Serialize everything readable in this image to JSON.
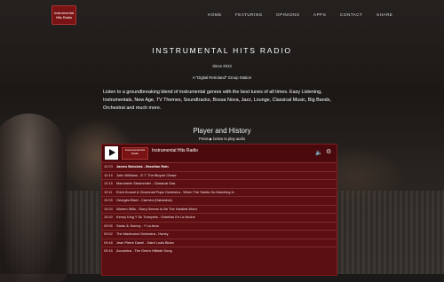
{
  "logo_text": "Instrumental Hits Radio",
  "nav": [
    "HOME",
    "FEATURING",
    "OPINIONS",
    "APPS",
    "CONTACT",
    "SHARE"
  ],
  "hero": {
    "title": "INSTRUMENTAL HITS RADIO",
    "since": "Since 2013",
    "group": "A \"Digital Retroland\" Group Station",
    "description": "Listen to a groundbreaking blend of instrumental genres with the best tunes of all times. Easy Listening, Instrumentals, New Age, TV Themes, Soundtracks, Bossa Nova, Jazz,  Lounge, Classical Music, Big Bands, Orchestral and much more."
  },
  "player_section": {
    "heading": "Player and History",
    "press_before": "Press",
    "press_after": "below to play audio",
    "station_name": "Instrumental Hits Radio",
    "icons": {
      "play": "play-icon",
      "volume": "volume-icon",
      "settings": "gear-icon"
    },
    "tracks": [
      {
        "time": "10:23",
        "title": "James Bobchak - Brazilian Rain",
        "current": true
      },
      {
        "time": "10:19",
        "title": "John Williams - E.T. The Bicycle Chase"
      },
      {
        "time": "10:15",
        "title": "Mannheim Steamroller - Classical Gas"
      },
      {
        "time": "10:11",
        "title": "Erich Kunzel & Cincinnati Pops Orchestra - When The Saints Go Marching In"
      },
      {
        "time": "10:09",
        "title": "Georges Bizet - Carmen (Habanera)"
      },
      {
        "time": "10:04",
        "title": "Warren Wills - Sorry Seems to Be The Hardest Word"
      },
      {
        "time": "10:00",
        "title": "Kenny King Y Su Trompeta - Estrellas En La Noche"
      },
      {
        "time": "09:55",
        "title": "Santo & Jhonny - Y La Ama"
      },
      {
        "time": "09:52",
        "title": "The Mantovani Orchestra - Honey"
      },
      {
        "time": "09:48",
        "title": "Jean Pierre Danel - Saint Louis Blues"
      },
      {
        "time": "09:45",
        "title": "Acoustica - The Green Hillside Song"
      }
    ]
  },
  "colors": {
    "accent": "#5c0f12",
    "logo": "#7a1414"
  }
}
